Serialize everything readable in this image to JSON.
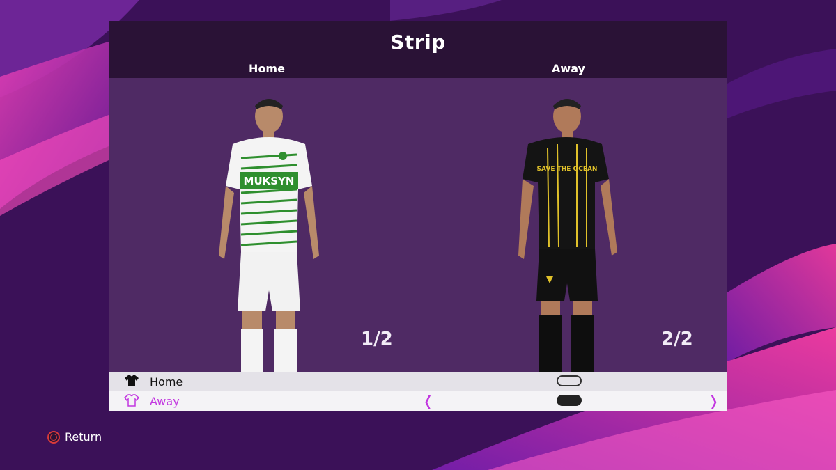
{
  "panel": {
    "title": "Strip",
    "columns": [
      "Home",
      "Away"
    ],
    "counters": [
      "1/2",
      "2/2"
    ]
  },
  "options": [
    {
      "label": "Home",
      "icon": "shirt-icon",
      "selected": false,
      "toggle_on": false
    },
    {
      "label": "Away",
      "icon": "shirt-outline-icon",
      "selected": true,
      "toggle_on": true
    }
  ],
  "arrows": {
    "left": "❬",
    "right": "❭"
  },
  "footer": {
    "return_label": "Return",
    "return_icon": "circle-button-icon"
  },
  "colors": {
    "accent": "#c236e0",
    "header_bg": "#2a1236",
    "preview_bg": "#4f2a64",
    "home_kit": "#2f8f2f",
    "away_kit": "#e0c12a"
  }
}
